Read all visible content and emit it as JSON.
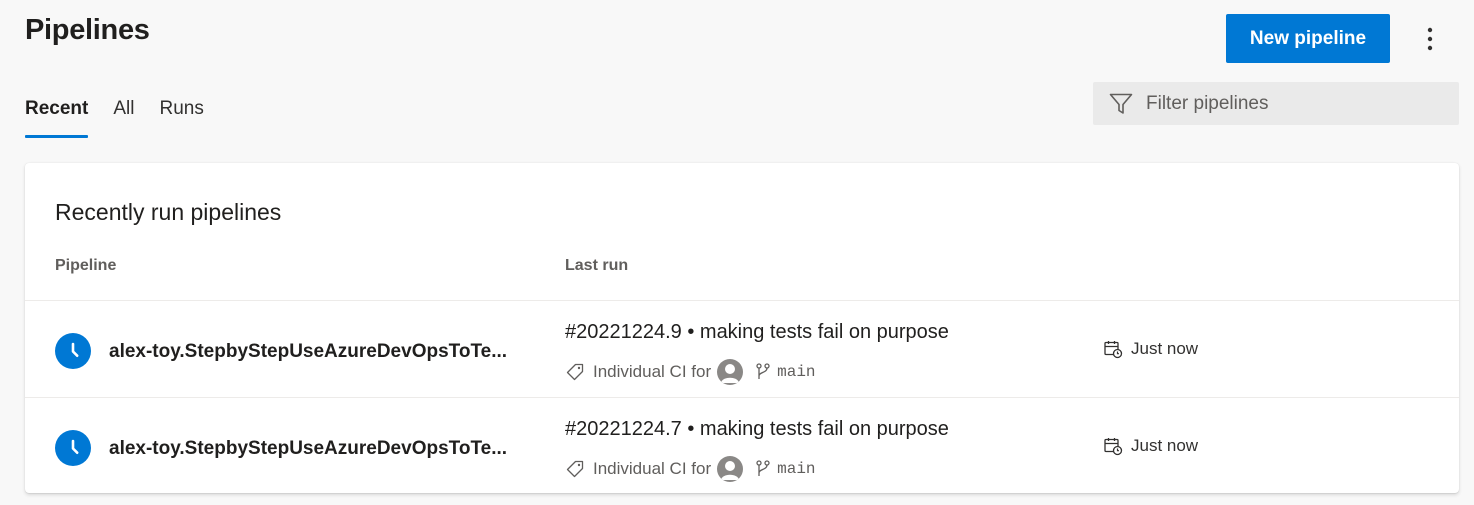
{
  "header": {
    "title": "Pipelines",
    "new_pipeline_label": "New pipeline",
    "more_icon": "more-vertical-icon"
  },
  "tabs": [
    {
      "label": "Recent",
      "active": true
    },
    {
      "label": "All",
      "active": false
    },
    {
      "label": "Runs",
      "active": false
    }
  ],
  "filter": {
    "placeholder": "Filter pipelines",
    "icon": "filter-icon"
  },
  "card": {
    "title": "Recently run pipelines",
    "columns": {
      "pipeline": "Pipeline",
      "last_run": "Last run"
    },
    "rows": [
      {
        "status_icon": "clock-icon",
        "name": "alex-toy.StepbyStepUseAzureDevOpsToTe...",
        "run_title": "#20221224.9 • making tests fail on purpose",
        "trigger": "Individual CI for",
        "branch": "main",
        "when": "Just now"
      },
      {
        "status_icon": "clock-icon",
        "name": "alex-toy.StepbyStepUseAzureDevOpsToTe...",
        "run_title": "#20221224.7 • making tests fail on purpose",
        "trigger": "Individual CI for",
        "branch": "main",
        "when": "Just now"
      }
    ]
  },
  "colors": {
    "accent": "#0078d4",
    "background": "#f8f8f8",
    "card": "#ffffff"
  }
}
